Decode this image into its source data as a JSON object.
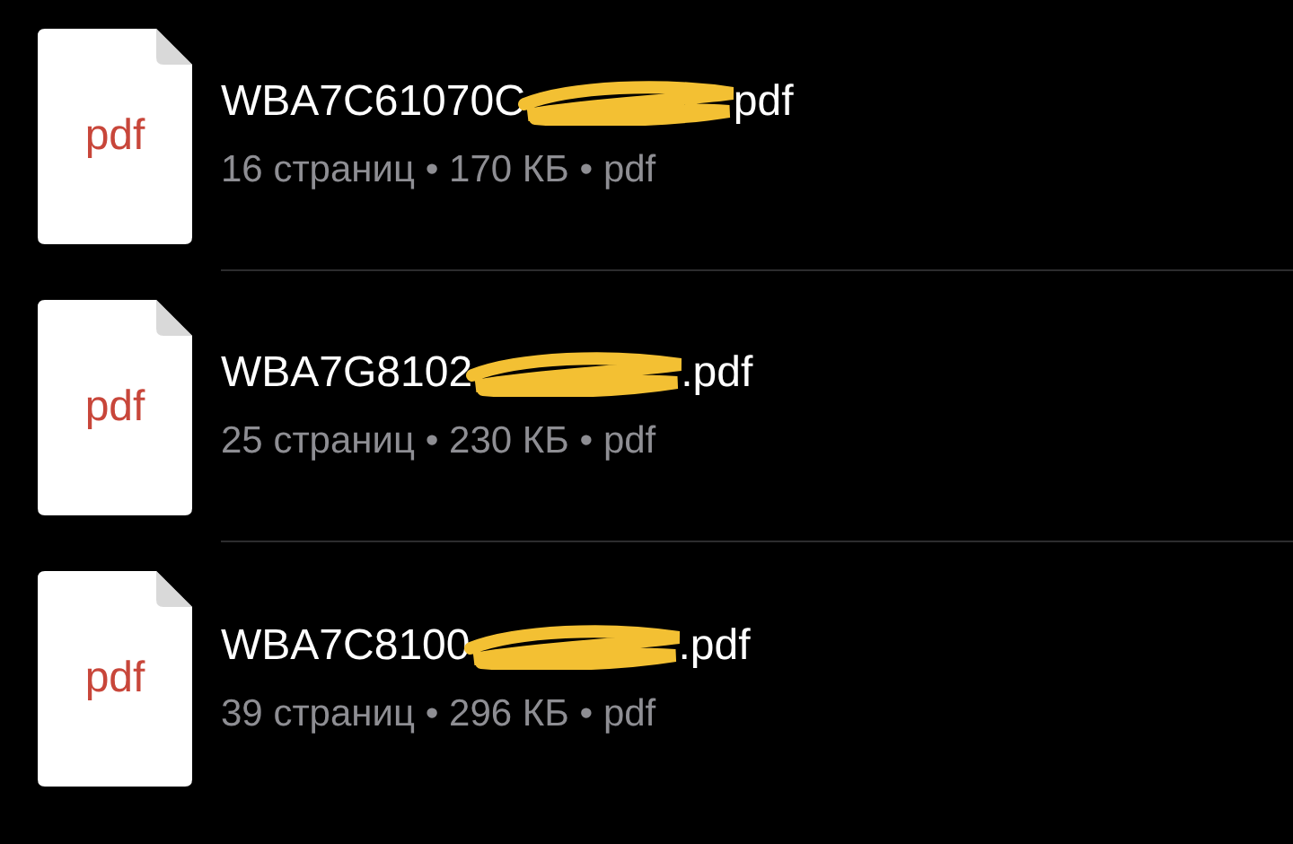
{
  "files": [
    {
      "icon_label": "pdf",
      "name_start": "WBA7C61070C",
      "name_end": "pdf",
      "meta": "16 страниц • 170 КБ • pdf"
    },
    {
      "icon_label": "pdf",
      "name_start": "WBA7G8102",
      "name_end": ".pdf",
      "meta": "25 страниц • 230 КБ • pdf"
    },
    {
      "icon_label": "pdf",
      "name_start": "WBA7C8100",
      "name_end": ".pdf",
      "meta": "39 страниц • 296 КБ • pdf"
    }
  ]
}
